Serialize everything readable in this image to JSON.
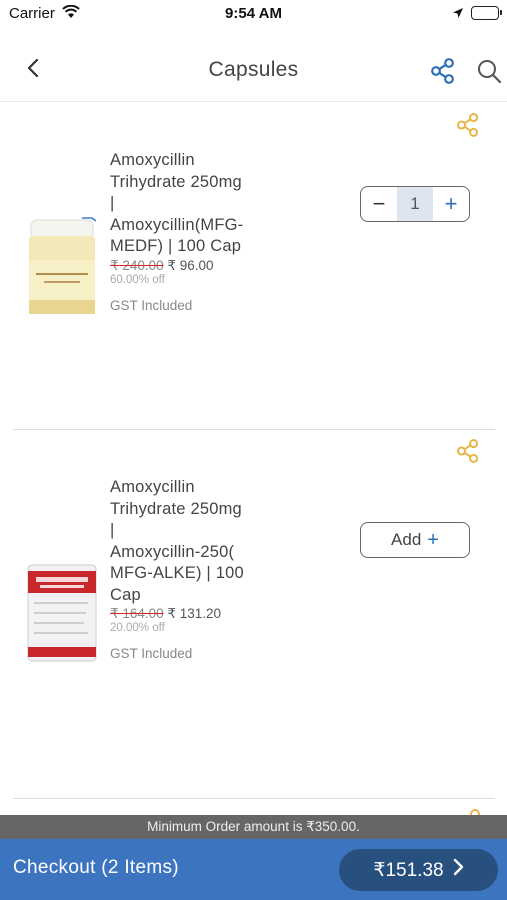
{
  "status_bar": {
    "carrier": "Carrier",
    "time": "9:54 AM"
  },
  "nav": {
    "title": "Capsules",
    "back_icon": "chevron-left-icon",
    "share_icon": "share-icon",
    "search_icon": "search-icon",
    "accent_color": "#2e6fb5"
  },
  "products": [
    {
      "name": "Amoxycillin Trihydrate 250mg | Amoxycillin(MFG-MEDF) | 100 Cap",
      "name_lines": [
        "Amoxycillin",
        "Trihydrate 250mg",
        "|",
        "Amoxycillin(MFG-",
        "MEDF) | 100 Cap"
      ],
      "mrp": "₹ 240.00",
      "price": "₹ 96.00",
      "discount": "60.00% off",
      "tax_note": "GST Included",
      "cart_state": "stepper",
      "quantity": "1",
      "minus_label": "−",
      "plus_label": "+"
    },
    {
      "name": "Amoxycillin Trihydrate 250mg | Amoxycillin-250(MFG-ALKE) | 100 Cap",
      "name_lines": [
        "Amoxycillin",
        "Trihydrate 250mg",
        "|",
        "Amoxycillin-250(",
        "MFG-ALKE) | 100",
        "Cap"
      ],
      "mrp": "₹ 164.00",
      "price": "₹ 131.20",
      "discount": "20.00% off",
      "tax_note": "GST Included",
      "cart_state": "add",
      "add_label": "Add",
      "plus_label": "+"
    }
  ],
  "card_share_icon_color": "#e8b54a",
  "min_order_text": "Minimum Order amount is ₹350.00.",
  "checkout": {
    "label": "Checkout (2 Items)",
    "total": "₹151.38",
    "bar_color": "#3d74c0"
  }
}
